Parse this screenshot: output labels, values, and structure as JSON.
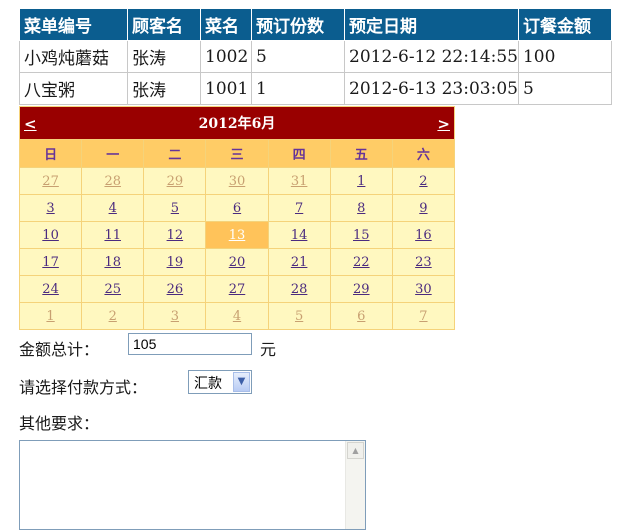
{
  "orders": {
    "headers": [
      "菜单编号",
      "顾客名",
      "菜名",
      "预订份数",
      "预定日期",
      "订餐金额"
    ],
    "rows": [
      [
        "小鸡炖蘑菇",
        "张涛",
        "1002",
        "5",
        "2012-6-12 22:14:55",
        "100"
      ],
      [
        "八宝粥",
        "张涛",
        "1001",
        "1",
        "2012-6-13 23:03:05",
        "5"
      ]
    ]
  },
  "calendar": {
    "prev": "<",
    "next": ">",
    "month_title": "2012年6月",
    "weekdays": [
      "日",
      "一",
      "二",
      "三",
      "四",
      "五",
      "六"
    ],
    "weeks": [
      [
        "27",
        "28",
        "29",
        "30",
        "31",
        "1",
        "2"
      ],
      [
        "3",
        "4",
        "5",
        "6",
        "7",
        "8",
        "9"
      ],
      [
        "10",
        "11",
        "12",
        "13",
        "14",
        "15",
        "16"
      ],
      [
        "17",
        "18",
        "19",
        "20",
        "21",
        "22",
        "23"
      ],
      [
        "24",
        "25",
        "26",
        "27",
        "28",
        "29",
        "30"
      ],
      [
        "1",
        "2",
        "3",
        "4",
        "5",
        "6",
        "7"
      ]
    ],
    "selected": "13",
    "colors": {
      "title_bg": "#990000",
      "header_bg": "#ffcc66",
      "cell_bg": "#fff8c0",
      "selected_bg": "#ffc35a"
    }
  },
  "form": {
    "total_label": "金额总计：",
    "total_value": "105",
    "total_unit": "元",
    "payment_label": "请选择付款方式：",
    "payment_selected": "汇款",
    "other_label": "其他要求："
  }
}
